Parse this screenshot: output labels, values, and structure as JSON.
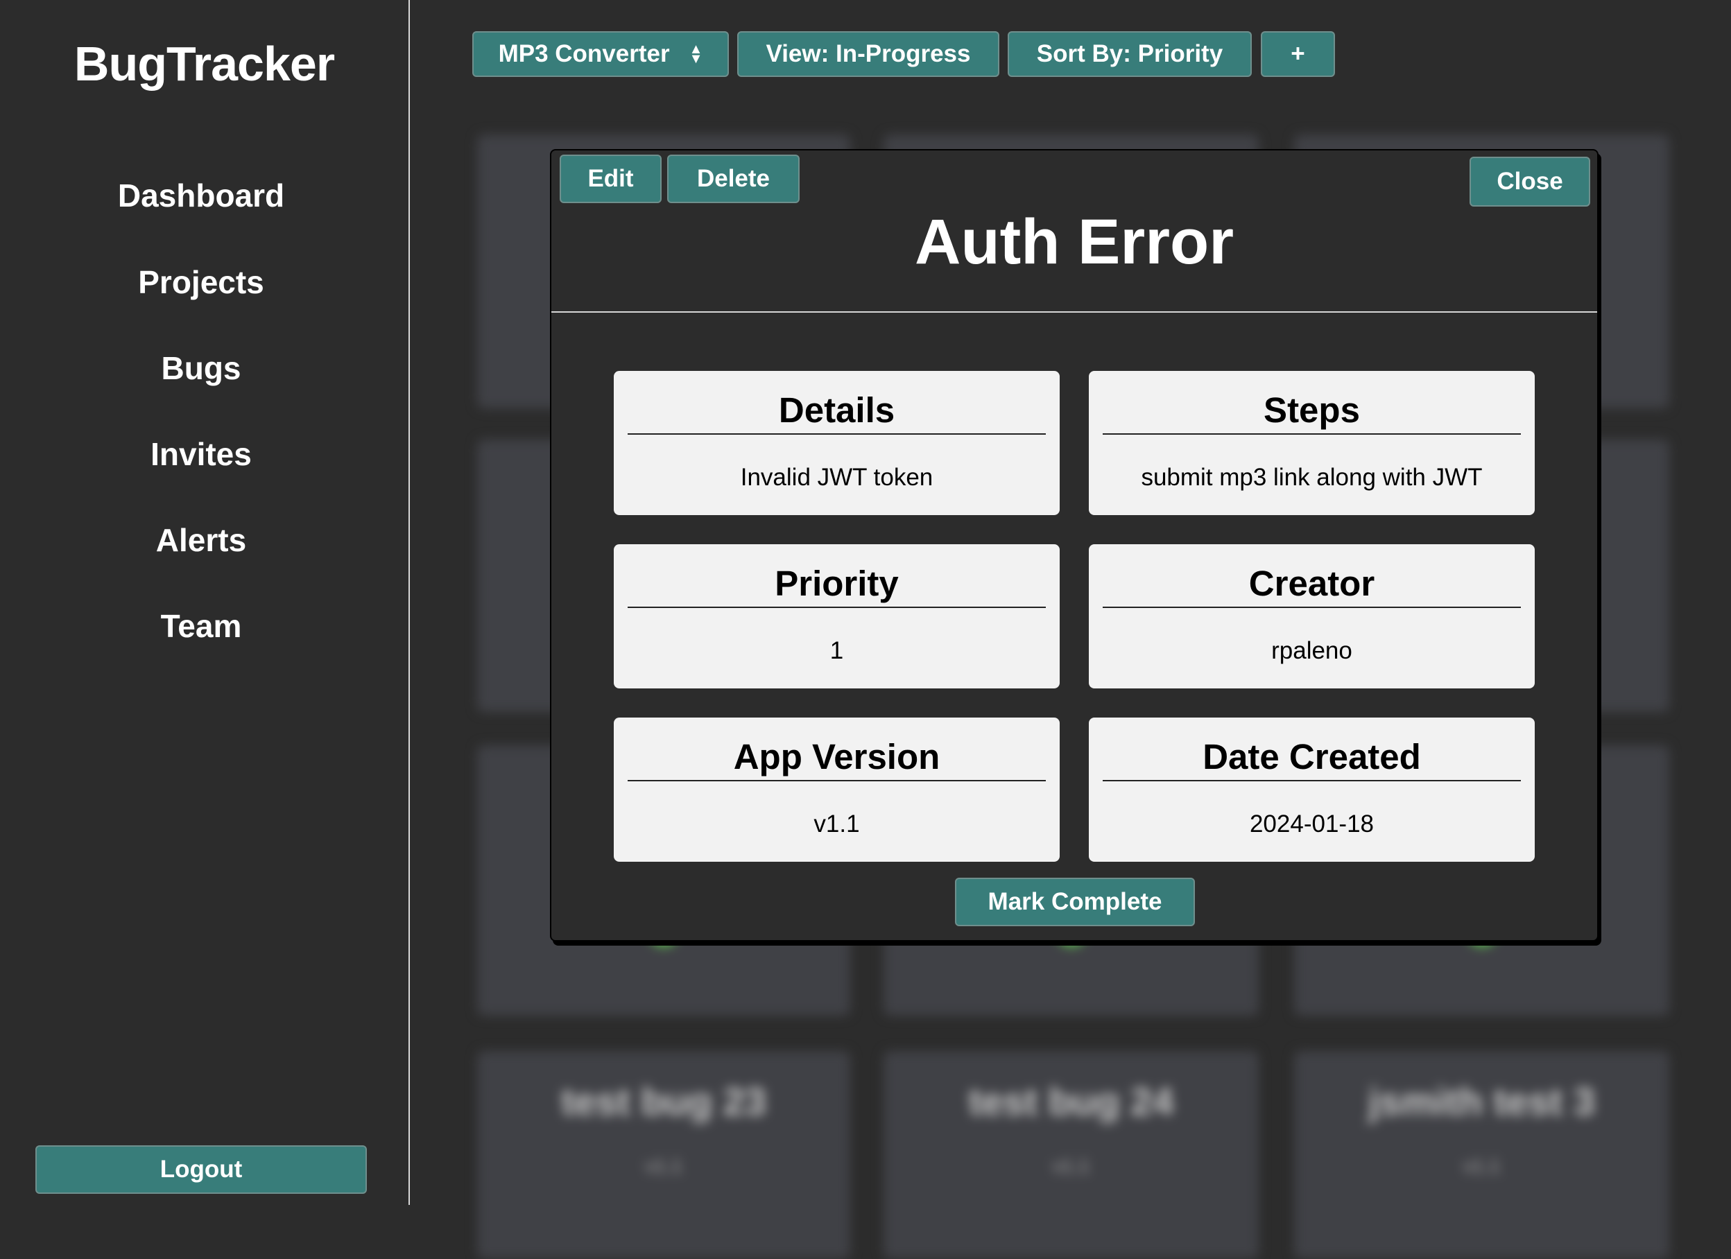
{
  "sidebar": {
    "brand": "BugTracker",
    "items": [
      "Dashboard",
      "Projects",
      "Bugs",
      "Invites",
      "Alerts",
      "Team"
    ],
    "logout": "Logout"
  },
  "toolbar": {
    "project": "MP3 Converter",
    "view": "View: In-Progress",
    "sort": "Sort By: Priority",
    "add": "+"
  },
  "background_cards": [
    {
      "title": "test bug 23",
      "sub": "v1.1"
    },
    {
      "title": "test bug 24",
      "sub": "v1.1"
    },
    {
      "title": "jsmith test 3",
      "sub": "v1.1"
    }
  ],
  "modal": {
    "edit": "Edit",
    "delete": "Delete",
    "close": "Close",
    "title": "Auth Error",
    "fields": [
      {
        "label": "Details",
        "value": "Invalid JWT token"
      },
      {
        "label": "Steps",
        "value": "submit mp3 link along with JWT"
      },
      {
        "label": "Priority",
        "value": "1"
      },
      {
        "label": "Creator",
        "value": "rpaleno"
      },
      {
        "label": "App Version",
        "value": "v1.1"
      },
      {
        "label": "Date Created",
        "value": "2024-01-18"
      }
    ],
    "mark_complete": "Mark Complete"
  },
  "colors": {
    "accent": "#387d7a",
    "background": "#2c2c2c",
    "card": "#f2f2f2"
  }
}
